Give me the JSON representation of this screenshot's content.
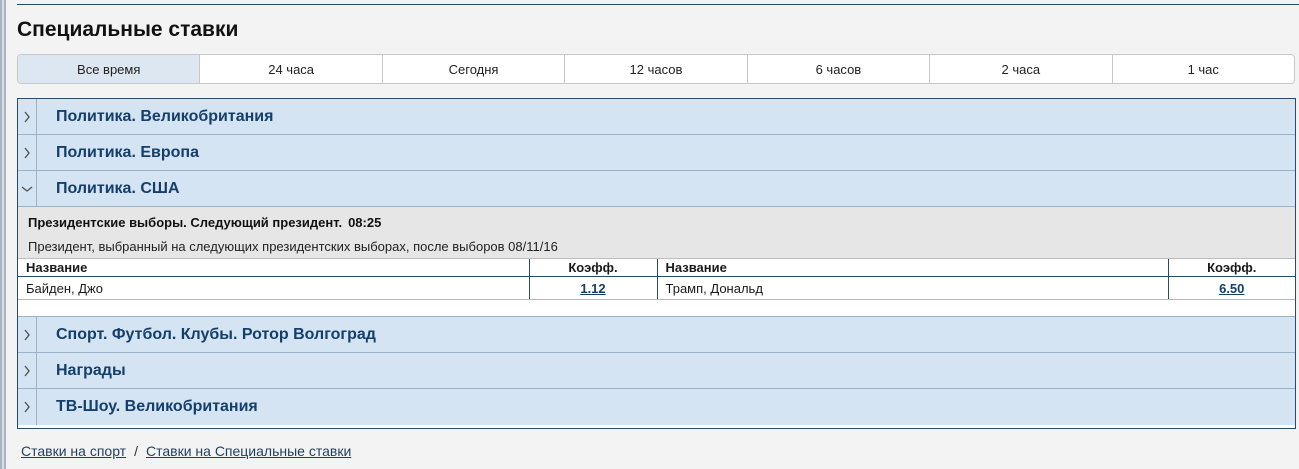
{
  "page": {
    "title": "Специальные ставки"
  },
  "tabs": [
    {
      "label": "Все время",
      "active": true
    },
    {
      "label": "24 часа"
    },
    {
      "label": "Сегодня"
    },
    {
      "label": "12 часов"
    },
    {
      "label": "6 часов"
    },
    {
      "label": "2 часа"
    },
    {
      "label": "1 час"
    }
  ],
  "categories": [
    {
      "label": "Политика. Великобритания",
      "expanded": false
    },
    {
      "label": "Политика. Европа",
      "expanded": false
    },
    {
      "label": "Политика. США",
      "expanded": true
    },
    {
      "label": "Спорт. Футбол. Клубы. Ротор Волгоград",
      "expanded": false
    },
    {
      "label": "Награды",
      "expanded": false
    },
    {
      "label": "ТВ-Шоу. Великобритания",
      "expanded": false
    }
  ],
  "event": {
    "title": "Президентские выборы. Следующий президент.",
    "time": "08:25",
    "description": "Президент, выбранный на следующих президентских выборах, после выборов 08/11/16",
    "columns": {
      "name": "Название",
      "coef": "Коэфф."
    },
    "selections": [
      {
        "name": "Байден, Джо",
        "coef": "1.12"
      },
      {
        "name": "Трамп, Дональд",
        "coef": "6.50"
      }
    ]
  },
  "breadcrumb": {
    "items": [
      "Ставки на спорт",
      "Ставки на Специальные ставки"
    ],
    "separator": "/"
  },
  "colors": {
    "accent": "#153f6a",
    "category_bg": "#d4e4f3",
    "active_tab_bg": "#dde7f1"
  },
  "icons": {
    "collapsed": "chevron-right-icon",
    "expanded": "chevron-down-icon"
  }
}
